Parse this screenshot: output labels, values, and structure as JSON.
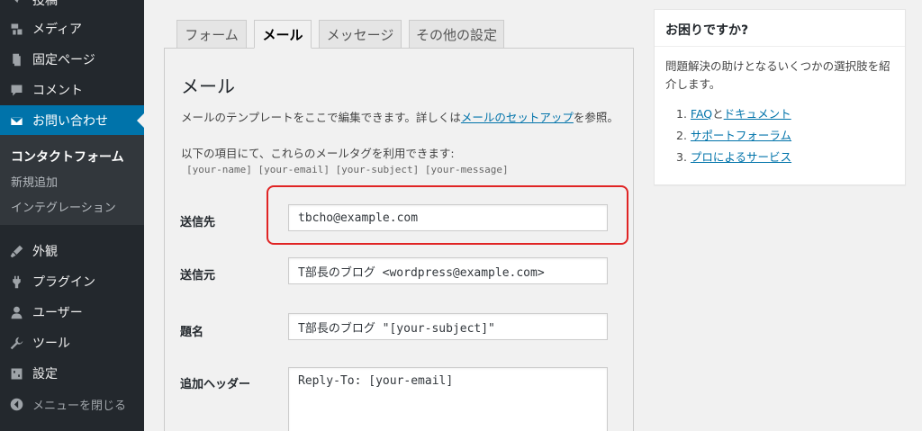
{
  "sidebar": {
    "items": [
      {
        "label": "投稿",
        "icon": "pin-icon"
      },
      {
        "label": "メディア",
        "icon": "media-icon"
      },
      {
        "label": "固定ページ",
        "icon": "page-icon"
      },
      {
        "label": "コメント",
        "icon": "comment-icon"
      },
      {
        "label": "お問い合わせ",
        "icon": "mail-icon"
      },
      {
        "label": "外観",
        "icon": "brush-icon"
      },
      {
        "label": "プラグイン",
        "icon": "plugin-icon"
      },
      {
        "label": "ユーザー",
        "icon": "user-icon"
      },
      {
        "label": "ツール",
        "icon": "wrench-icon"
      },
      {
        "label": "設定",
        "icon": "settings-icon"
      },
      {
        "label": "メニューを閉じる",
        "icon": "collapse-icon"
      }
    ],
    "submenu": [
      "コンタクトフォーム",
      "新規追加",
      "インテグレーション"
    ]
  },
  "tabs": [
    "フォーム",
    "メール",
    "メッセージ",
    "その他の設定"
  ],
  "panel": {
    "title": "メール",
    "desc_prefix": "メールのテンプレートをここで編集できます。詳しくは",
    "desc_link": "メールのセットアップ",
    "desc_suffix": "を参照。",
    "desc2": "以下の項目にて、これらのメールタグを利用できます:",
    "mail_tags": "[your-name] [your-email] [your-subject] [your-message]"
  },
  "fields": {
    "to": {
      "label": "送信先",
      "value": "tbcho@example.com"
    },
    "from": {
      "label": "送信元",
      "value": "T部長のブログ <wordpress@example.com>"
    },
    "subject": {
      "label": "題名",
      "value": "T部長のブログ \"[your-subject]\""
    },
    "headers": {
      "label": "追加ヘッダー",
      "value": "Reply-To: [your-email]"
    }
  },
  "help": {
    "title": "お困りですか?",
    "desc": "問題解決の助けとなるいくつかの選択肢を紹介します。",
    "links": [
      {
        "num": "1.",
        "link1": "FAQ",
        "mid": "と",
        "link2": "ドキュメント"
      },
      {
        "num": "2.",
        "link1": "サポートフォーラム"
      },
      {
        "num": "3.",
        "link1": "プロによるサービス"
      }
    ]
  },
  "colors": {
    "accent": "#0073aa",
    "sidebar": "#23282d",
    "highlight": "#e02424"
  }
}
